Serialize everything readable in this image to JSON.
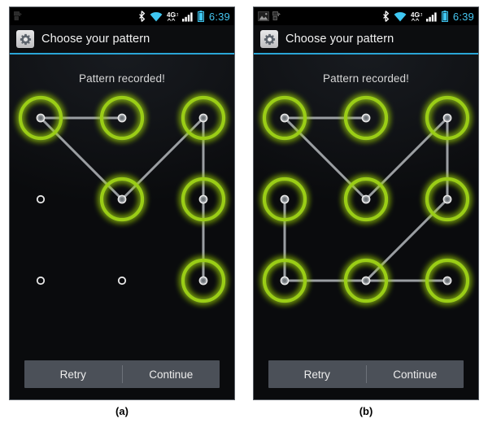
{
  "figure": {
    "panels": [
      {
        "caption": "(a)",
        "statusbar": {
          "left_icons": [
            "usb-debug-icon"
          ],
          "right_icons": [
            "bluetooth-icon",
            "wifi-icon",
            "lte-4g-icon",
            "signal-bars-icon",
            "battery-icon"
          ],
          "network_label": "4G",
          "time": "6:39"
        },
        "actionbar": {
          "icon": "settings-gear-icon",
          "title": "Choose your pattern"
        },
        "headline": "Pattern recorded!",
        "pattern": {
          "active_dots": [
            [
              0,
              0
            ],
            [
              1,
              0
            ],
            [
              2,
              0
            ],
            [
              1,
              1
            ],
            [
              2,
              1
            ],
            [
              2,
              2
            ]
          ],
          "path": [
            [
              0,
              0
            ],
            [
              1,
              0
            ]
          ],
          "segments": [
            [
              [
                0,
                0
              ],
              [
                1,
                0
              ]
            ],
            [
              [
                0,
                0
              ],
              [
                1,
                1
              ]
            ],
            [
              [
                1,
                1
              ],
              [
                2,
                0
              ]
            ],
            [
              [
                2,
                0
              ],
              [
                2,
                1
              ]
            ],
            [
              [
                2,
                1
              ],
              [
                2,
                2
              ]
            ]
          ]
        },
        "buttons": {
          "retry": "Retry",
          "continue": "Continue"
        }
      },
      {
        "caption": "(b)",
        "statusbar": {
          "left_icons": [
            "screenshot-image-icon",
            "usb-debug-icon"
          ],
          "right_icons": [
            "bluetooth-icon",
            "wifi-icon",
            "lte-4g-icon",
            "signal-bars-icon",
            "battery-icon"
          ],
          "network_label": "4G",
          "time": "6:39"
        },
        "actionbar": {
          "icon": "settings-gear-icon",
          "title": "Choose your pattern"
        },
        "headline": "Pattern recorded!",
        "pattern": {
          "active_dots": [
            [
              0,
              0
            ],
            [
              1,
              0
            ],
            [
              2,
              0
            ],
            [
              0,
              1
            ],
            [
              1,
              1
            ],
            [
              2,
              1
            ],
            [
              0,
              2
            ],
            [
              1,
              2
            ],
            [
              2,
              2
            ]
          ],
          "path": [
            [
              0,
              0
            ],
            [
              1,
              0
            ]
          ],
          "segments": [
            [
              [
                0,
                0
              ],
              [
                1,
                0
              ]
            ],
            [
              [
                0,
                0
              ],
              [
                1,
                1
              ]
            ],
            [
              [
                1,
                1
              ],
              [
                2,
                0
              ]
            ],
            [
              [
                2,
                0
              ],
              [
                2,
                1
              ]
            ],
            [
              [
                2,
                1
              ],
              [
                1,
                2
              ]
            ],
            [
              [
                1,
                2
              ],
              [
                0,
                2
              ]
            ],
            [
              [
                0,
                2
              ],
              [
                0,
                1
              ]
            ],
            [
              [
                1,
                2
              ],
              [
                2,
                2
              ]
            ]
          ]
        },
        "buttons": {
          "retry": "Retry",
          "continue": "Continue"
        }
      }
    ]
  },
  "colors": {
    "accent_blue": "#2aa5d6",
    "status_time": "#45c6f0",
    "pattern_active": "#9acd14",
    "pattern_line": "#b4b8bc",
    "pattern_inactive": "#e8e8e8",
    "button_bg": "#4b5058",
    "screen_bg": "#0a0b0d"
  }
}
